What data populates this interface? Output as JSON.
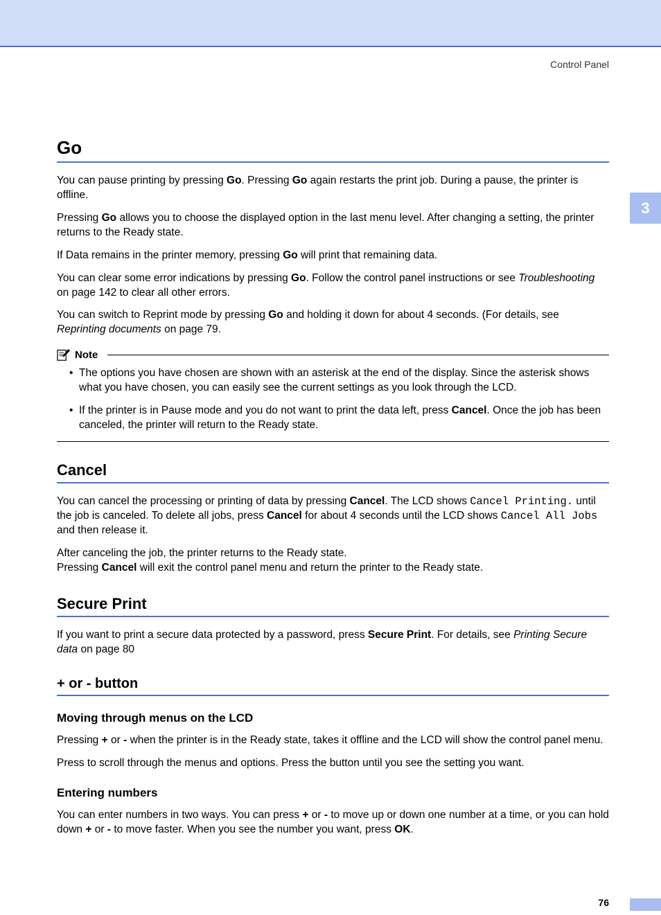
{
  "header": {
    "label": "Control Panel"
  },
  "chapter": {
    "number": "3"
  },
  "footer": {
    "page": "76"
  },
  "go": {
    "title": "Go",
    "p1": {
      "a": "You can pause printing by pressing ",
      "b1": "Go",
      "b": ". Pressing ",
      "b2": "Go",
      "c": " again restarts the print job. During a pause, the printer is offline."
    },
    "p2": {
      "a": "Pressing ",
      "b1": "Go",
      "b": " allows you to choose the displayed option in the last menu level. After changing a setting, the printer returns to the Ready state."
    },
    "p3": {
      "a": "If Data remains in the printer memory, pressing ",
      "b1": "Go",
      "b": " will print that remaining data."
    },
    "p4": {
      "a": "You can clear some error indications by pressing ",
      "b1": "Go",
      "b": ". Follow the control panel instructions or see ",
      "i1": "Troubleshooting",
      "c": " on page 142 to clear all other errors."
    },
    "p5": {
      "a": "You can switch to Reprint mode by pressing ",
      "b1": "Go",
      "b": " and holding it down for about 4 seconds. (For details, see ",
      "i1": "Reprinting documents",
      "c": " on page 79."
    }
  },
  "note": {
    "label": "Note",
    "li1": "The options you have chosen are shown with an asterisk at the end of the display. Since the asterisk shows what you have chosen, you can easily see the current settings as you look through the LCD.",
    "li2": {
      "a": "If the printer is in Pause mode and you do not want to print the data left, press ",
      "b1": "Cancel",
      "b": ". Once the job has been canceled, the printer will return to the Ready state."
    }
  },
  "cancel": {
    "title": "Cancel",
    "p1": {
      "a": "You can cancel the processing or printing of data by pressing ",
      "b1": "Cancel",
      "b": ". The LCD shows ",
      "m1": "Cancel Printing.",
      "c": " until the job is canceled. To delete all jobs, press ",
      "b2": "Cancel",
      "d": " for about 4 seconds until the LCD shows ",
      "m2": "Cancel All Jobs",
      "e": " and then release it."
    },
    "p2": {
      "a": "After canceling the job, the printer returns to the Ready state.",
      "br": "",
      "b": "Pressing ",
      "b1": "Cancel",
      "c": " will exit the control panel menu and return the printer to the Ready state."
    }
  },
  "secure": {
    "title": "Secure Print",
    "p1": {
      "a": "If you want to print a secure data protected by a password, press ",
      "b1": "Secure Print",
      "b": ". For details, see ",
      "i1": "Printing Secure data",
      "c": " on page 80"
    }
  },
  "pm": {
    "title": "+ or - button",
    "h1": "Moving through menus on the LCD",
    "p1": {
      "a": "Pressing ",
      "b1": "+",
      "b": " or ",
      "b2": "-",
      "c": " when the printer is in the Ready state, takes it offline and the LCD will show the control panel menu."
    },
    "p2": "Press to scroll through the menus and options. Press the button until you see the setting you want.",
    "h2": "Entering numbers",
    "p3": {
      "a": "You can enter numbers in two ways. You can press ",
      "b1": "+",
      "b": " or ",
      "b2": "-",
      "c": " to move up or down one number at a time, or you can hold down ",
      "b3": "+",
      "d": " or ",
      "b4": "-",
      "e": " to move faster. When you see the number you want, press ",
      "b5": "OK",
      "f": "."
    }
  }
}
